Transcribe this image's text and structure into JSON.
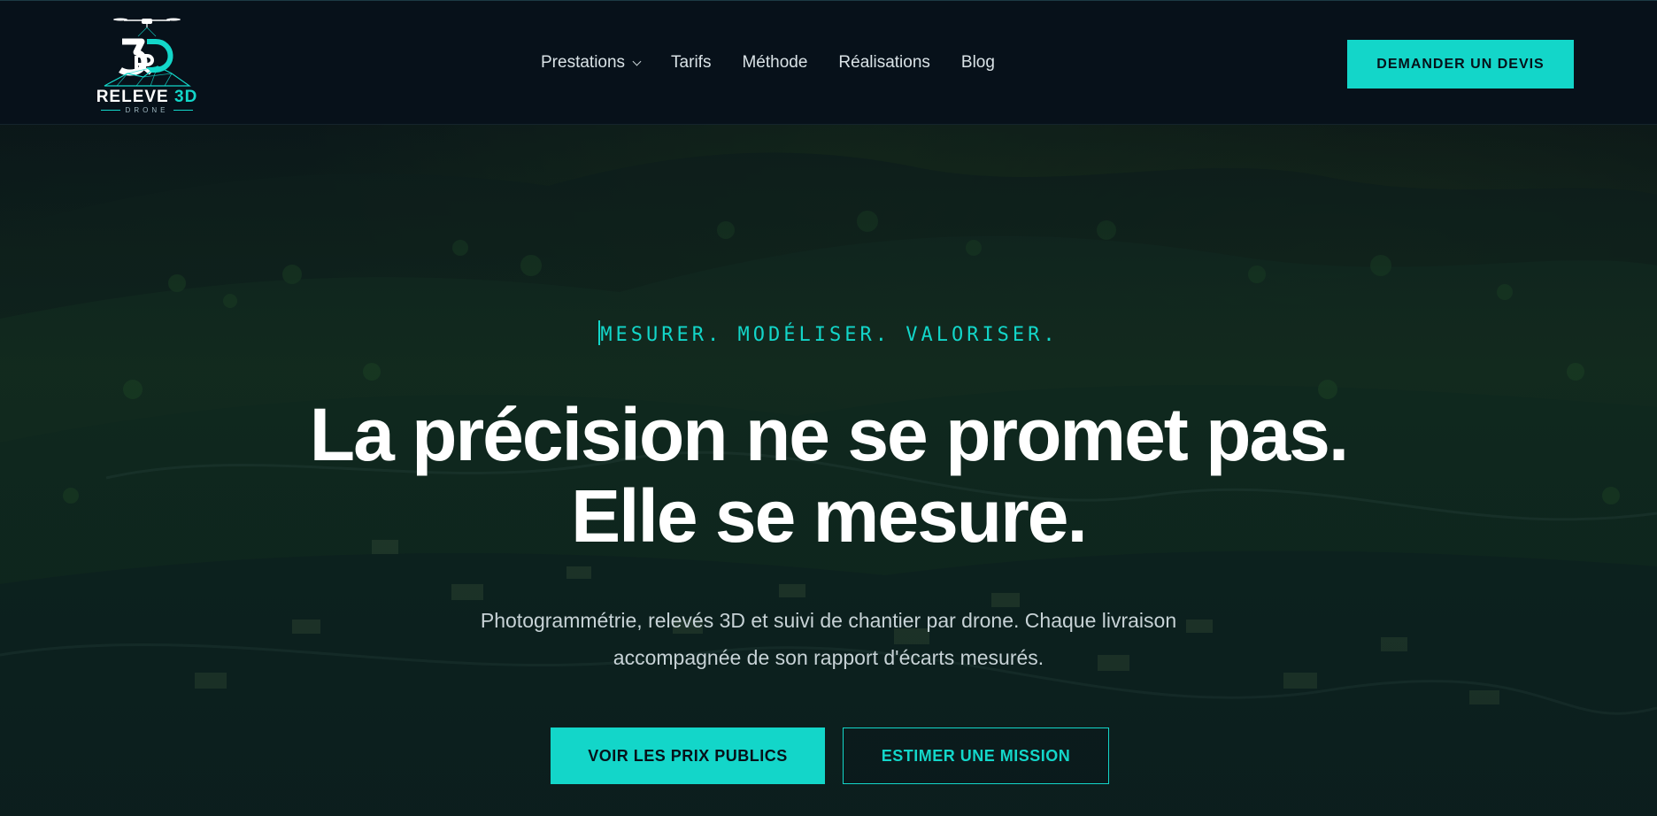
{
  "brand": {
    "logo_word": "RELEVE",
    "logo_word_accent": "3D",
    "logo_sub": "DRONE",
    "icon": "drone-3d-logo-icon"
  },
  "nav": {
    "items": [
      {
        "label": "Prestations",
        "has_dropdown": true
      },
      {
        "label": "Tarifs",
        "has_dropdown": false
      },
      {
        "label": "Méthode",
        "has_dropdown": false
      },
      {
        "label": "Réalisations",
        "has_dropdown": false
      },
      {
        "label": "Blog",
        "has_dropdown": false
      }
    ]
  },
  "header": {
    "cta_label": "DEMANDER UN DEVIS"
  },
  "hero": {
    "tagline": "MESURER. MODÉLISER. VALORISER.",
    "headline_line1": "La précision ne se promet pas.",
    "headline_line2": "Elle se mesure.",
    "subtext_line1": "Photogrammétrie, relevés 3D et suivi de chantier par drone. Chaque livraison",
    "subtext_line2": "accompagnée de son rapport d'écarts mesurés.",
    "primary_button": "VOIR LES PRIX PUBLICS",
    "secondary_button": "ESTIMER UNE MISSION",
    "background": "aerial-forest-village-image"
  },
  "colors": {
    "accent": "#13d6c9",
    "background": "#07111a",
    "text_primary": "#ffffff",
    "text_secondary": "#c7d2d6"
  }
}
